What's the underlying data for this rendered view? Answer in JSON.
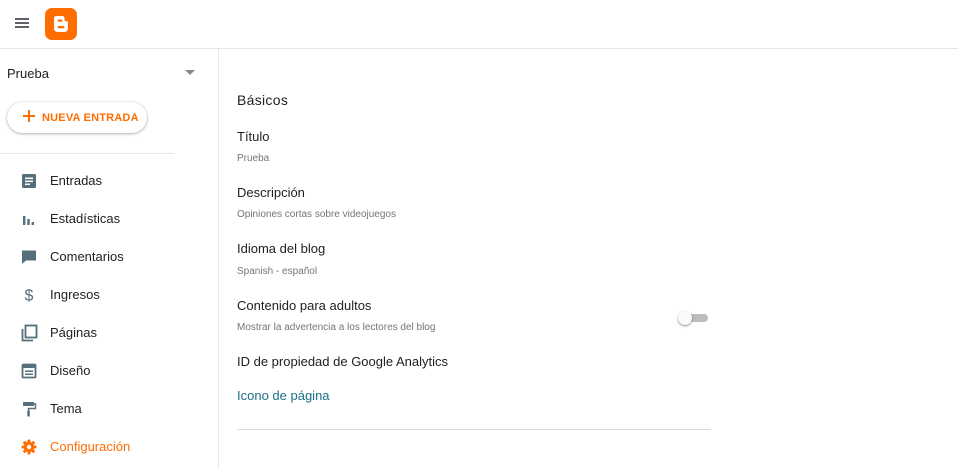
{
  "colors": {
    "brand": "#ff6d00",
    "text": "#212121",
    "muted": "#757575",
    "link": "#1a6f8a",
    "icon": "#546e7a"
  },
  "header": {
    "menu_icon": "hamburger-menu-icon",
    "logo": "blogger-logo"
  },
  "sidebar": {
    "blog_name": "Prueba",
    "new_post_label": "NUEVA ENTRADA",
    "items": [
      {
        "label": "Entradas",
        "icon": "posts-icon"
      },
      {
        "label": "Estadísticas",
        "icon": "stats-icon"
      },
      {
        "label": "Comentarios",
        "icon": "comments-icon"
      },
      {
        "label": "Ingresos",
        "icon": "dollar-icon"
      },
      {
        "label": "Páginas",
        "icon": "pages-icon"
      },
      {
        "label": "Diseño",
        "icon": "layout-icon"
      },
      {
        "label": "Tema",
        "icon": "paint-roller-icon"
      },
      {
        "label": "Configuración",
        "icon": "gear-icon",
        "active": true
      }
    ]
  },
  "main": {
    "section_title": "Básicos",
    "fields": [
      {
        "label": "Título",
        "value": "Prueba"
      },
      {
        "label": "Descripción",
        "value": "Opiniones cortas sobre videojuegos"
      },
      {
        "label": "Idioma del blog",
        "value": "Spanish - español"
      },
      {
        "label": "Contenido para adultos",
        "value": "Mostrar la advertencia a los lectores del blog",
        "toggle_on": false
      },
      {
        "label": "ID de propiedad de Google Analytics"
      }
    ],
    "favicon_link": "Icono de página"
  }
}
